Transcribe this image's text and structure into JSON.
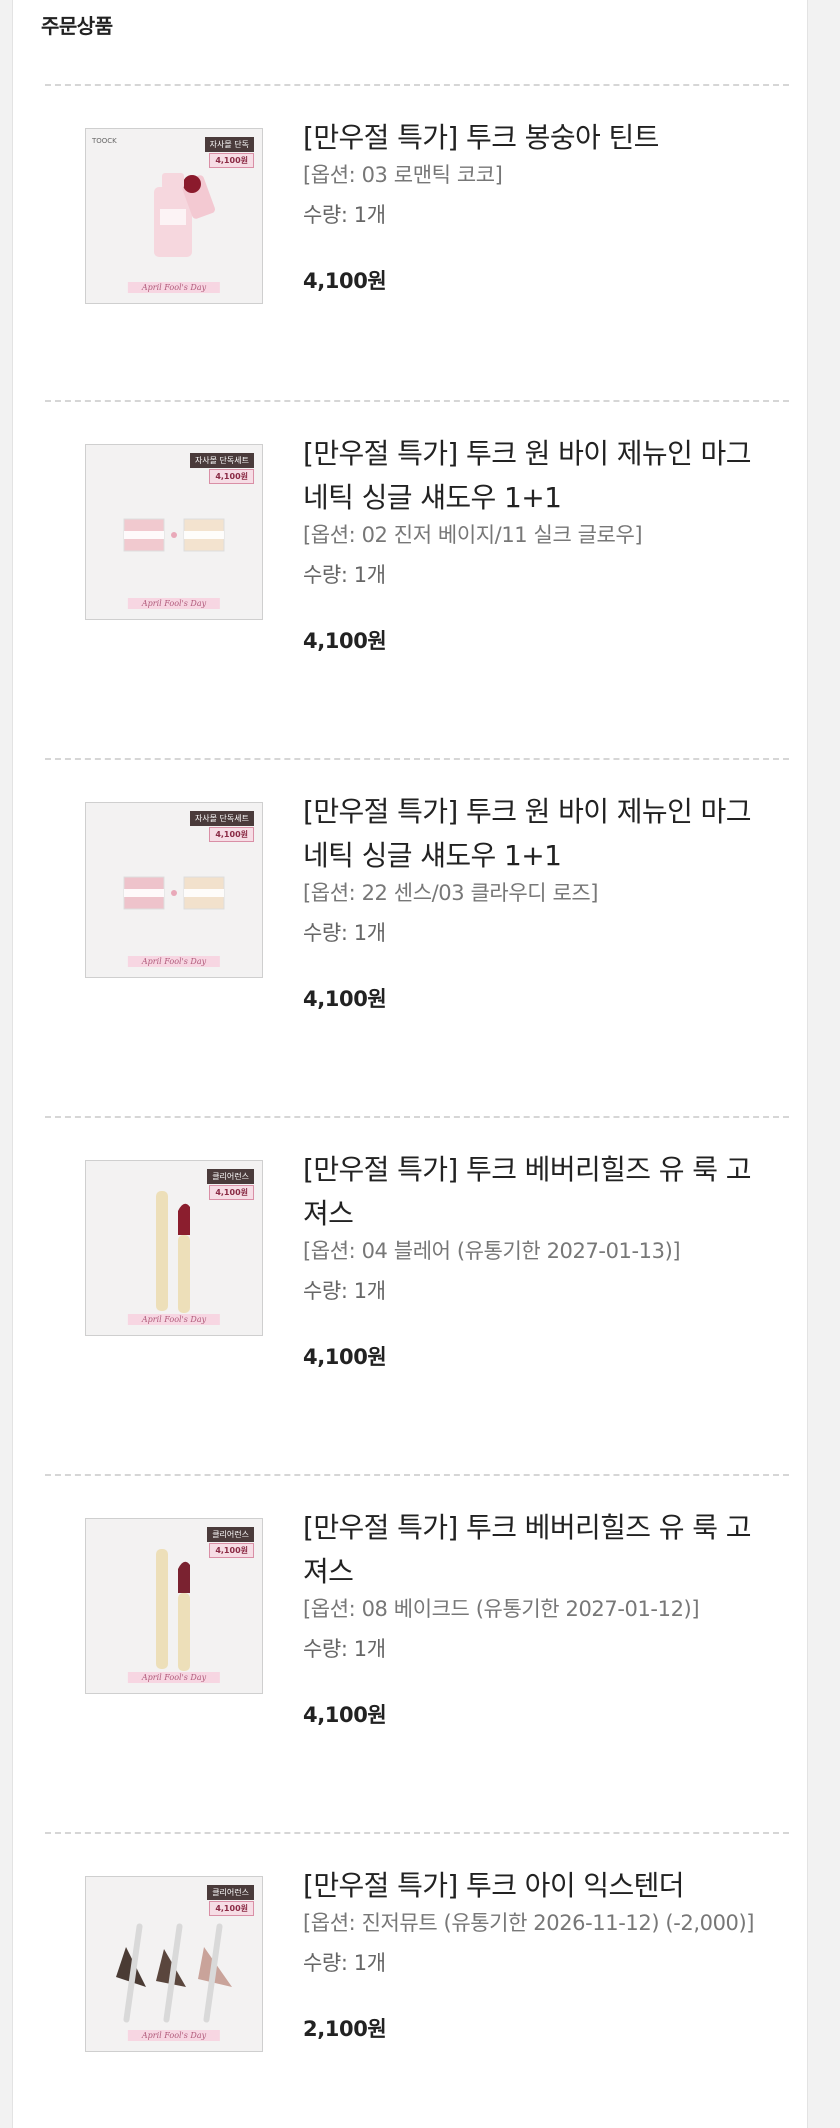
{
  "section_title": "주문상품",
  "items": [
    {
      "name": "[만우절 특가] 투크 봉숭아 틴트",
      "option": "[옵션: 03 로맨틱 코코]",
      "qty": "수량: 1개",
      "price": "4,100원",
      "tag": "자사몰 단독",
      "thumb_price": "4,100원",
      "thumb_caption": "April Fool's Day",
      "brand": "TOOCK",
      "icon": "tint-bottle-icon"
    },
    {
      "name": "[만우절 특가] 투크 원 바이 제뉴인 마그네틱 싱글 섀도우 1+1",
      "option": "[옵션: 02 진저 베이지/11 실크 글로우]",
      "qty": "수량: 1개",
      "price": "4,100원",
      "tag": "자사몰 단독세트",
      "thumb_price": "4,100원",
      "thumb_caption": "April Fool's Day",
      "icon": "eyeshadow-pair-icon"
    },
    {
      "name": "[만우절 특가] 투크 원 바이 제뉴인 마그네틱 싱글 섀도우 1+1",
      "option": "[옵션: 22 센스/03 클라우디 로즈]",
      "qty": "수량: 1개",
      "price": "4,100원",
      "tag": "자사몰 단독세트",
      "thumb_price": "4,100원",
      "thumb_caption": "April Fool's Day",
      "icon": "eyeshadow-pair-icon"
    },
    {
      "name": "[만우절 특가] 투크 베버리힐즈 유 룩 고져스",
      "option": "[옵션: 04 블레어 (유통기한 2027-01-13)]",
      "qty": "수량: 1개",
      "price": "4,100원",
      "tag": "클리어런스",
      "thumb_price": "4,100원",
      "thumb_caption": "April Fool's Day",
      "icon": "lipstick-icon"
    },
    {
      "name": "[만우절 특가] 투크 베버리힐즈 유 룩 고져스",
      "option": "[옵션: 08 베이크드 (유통기한 2027-01-12)]",
      "qty": "수량: 1개",
      "price": "4,100원",
      "tag": "클리어런스",
      "thumb_price": "4,100원",
      "thumb_caption": "April Fool's Day",
      "icon": "lipstick-icon"
    },
    {
      "name": "[만우절 특가] 투크 아이 익스텐더",
      "option": "[옵션: 진저뮤트 (유통기한 2026-11-12) (-2,000)]",
      "qty": "수량: 1개",
      "price": "2,100원",
      "tag": "클리어런스",
      "thumb_price": "4,100원",
      "thumb_caption": "April Fool's Day",
      "icon": "eyeliner-pencils-icon"
    }
  ]
}
